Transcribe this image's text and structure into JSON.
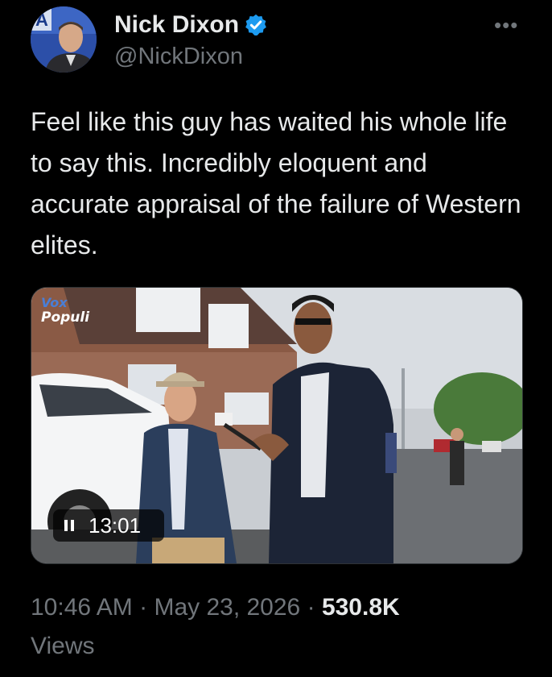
{
  "author": {
    "name": "Nick Dixon",
    "handle": "@NickDixon",
    "verified": true,
    "verified_color": "#1d9bf0",
    "avatar_icon": "profile-photo"
  },
  "more_icon": "more-options-icon",
  "tweet": {
    "text": "Feel like this guy has waited his whole life to say this. Incredibly eloquent and accurate appraisal of the failure of Western elites."
  },
  "media": {
    "watermark_line1": "Vox",
    "watermark_line2": "Populi",
    "duration": "13:01",
    "state_icon": "pause-icon"
  },
  "meta": {
    "time": "10:46 AM",
    "separator": "·",
    "date": "May 23, 2026",
    "views_count": "530.8K",
    "views_label": "Views"
  }
}
